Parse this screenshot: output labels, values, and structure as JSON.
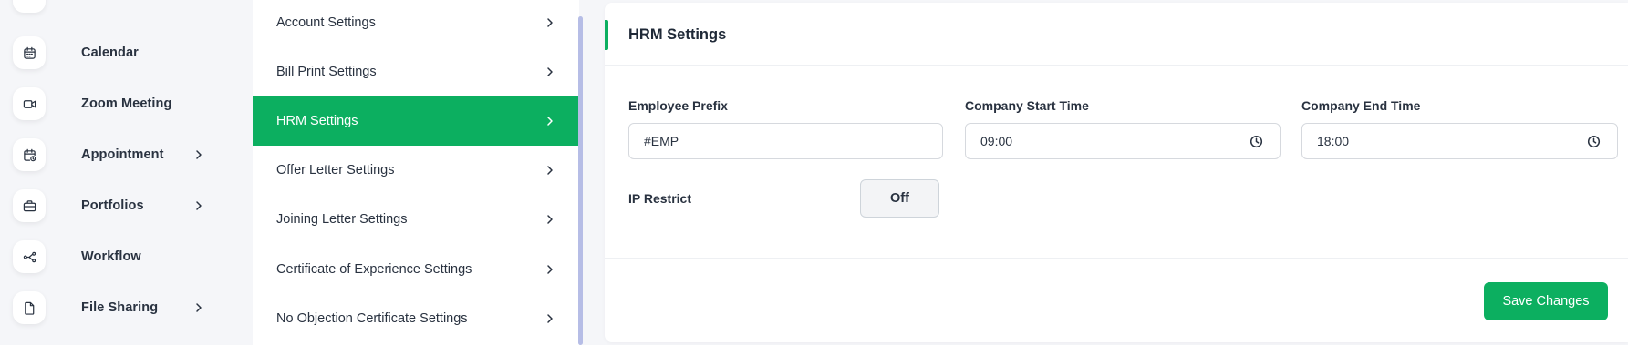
{
  "sidebar": {
    "items": [
      {
        "label": "Calendar",
        "icon": "calendar-icon",
        "has_submenu": false
      },
      {
        "label": "Zoom Meeting",
        "icon": "video-icon",
        "has_submenu": false
      },
      {
        "label": "Appointment",
        "icon": "calendar-clock-icon",
        "has_submenu": true
      },
      {
        "label": "Portfolios",
        "icon": "briefcase-icon",
        "has_submenu": true
      },
      {
        "label": "Workflow",
        "icon": "workflow-icon",
        "has_submenu": false
      },
      {
        "label": "File Sharing",
        "icon": "file-icon",
        "has_submenu": true
      }
    ]
  },
  "settings_nav": {
    "items": [
      {
        "label": "Account Settings",
        "active": false
      },
      {
        "label": "Bill Print Settings",
        "active": false
      },
      {
        "label": "HRM Settings",
        "active": true
      },
      {
        "label": "Offer Letter Settings",
        "active": false
      },
      {
        "label": "Joining Letter Settings",
        "active": false
      },
      {
        "label": "Certificate of Experience Settings",
        "active": false
      },
      {
        "label": "No Objection Certificate Settings",
        "active": false
      }
    ]
  },
  "hrm": {
    "title": "HRM Settings",
    "employee_prefix": {
      "label": "Employee Prefix",
      "value": "#EMP"
    },
    "start_time": {
      "label": "Company Start Time",
      "value": "09:00"
    },
    "end_time": {
      "label": "Company End Time",
      "value": "18:00"
    },
    "ip_restrict": {
      "label": "IP Restrict",
      "state": "Off"
    },
    "save_label": "Save Changes"
  },
  "colors": {
    "accent": "#0caf60",
    "text": "#293240",
    "page_bg": "#f5f6f9",
    "scrollbar": "#b6bde6"
  }
}
